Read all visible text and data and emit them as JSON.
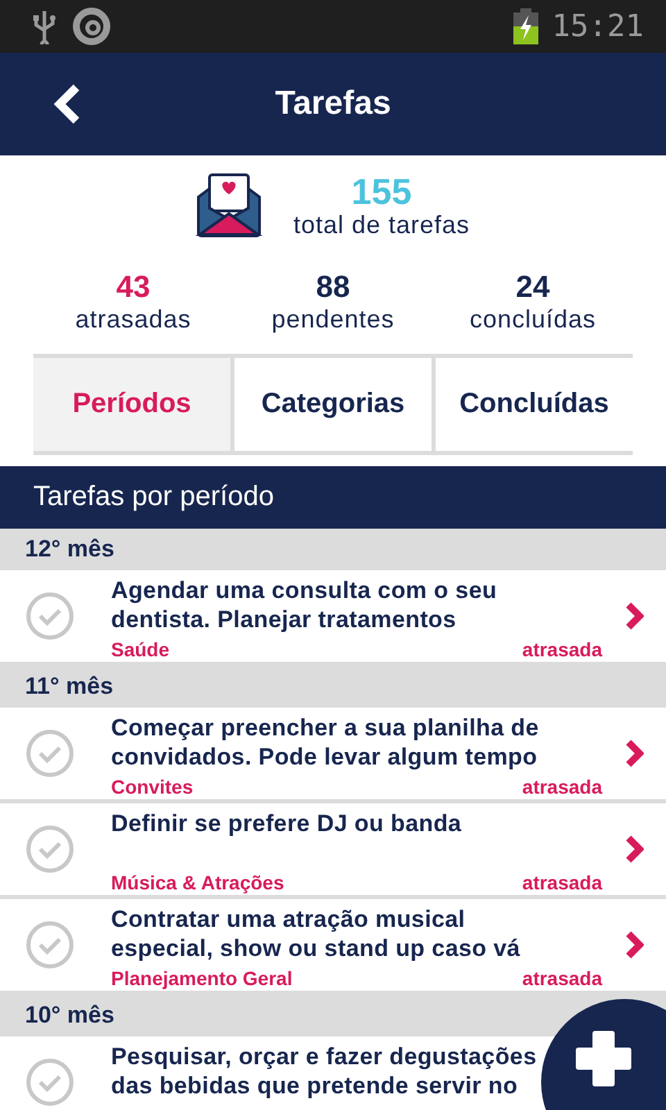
{
  "status_bar": {
    "time": "15:21"
  },
  "header": {
    "title": "Tarefas"
  },
  "summary": {
    "total": "155",
    "total_label": "total de tarefas",
    "stats": [
      {
        "value": "43",
        "label": "atrasadas",
        "color": "#d81b5c"
      },
      {
        "value": "88",
        "label": "pendentes",
        "color": "#17264f"
      },
      {
        "value": "24",
        "label": "concluídas",
        "color": "#17264f"
      }
    ]
  },
  "tabs": [
    {
      "label": "Períodos",
      "selected": true
    },
    {
      "label": "Categorias",
      "selected": false
    },
    {
      "label": "Concluídas",
      "selected": false
    }
  ],
  "section": {
    "title": "Tarefas por período"
  },
  "groups": [
    {
      "title": "12° mês",
      "tasks": [
        {
          "title": "Agendar uma consulta com o seu dentista. Planejar tratamentos",
          "category": "Saúde",
          "status": "atrasada",
          "checked": false
        }
      ]
    },
    {
      "title": "11° mês",
      "tasks": [
        {
          "title": "Começar preencher a sua planilha de convidados. Pode levar algum tempo",
          "category": "Convites",
          "status": "atrasada",
          "checked": false
        },
        {
          "title": "Definir se prefere DJ ou banda",
          "category": "Música & Atrações",
          "status": "atrasada",
          "checked": false
        },
        {
          "title": "Contratar uma atração musical especial, show ou stand up caso vá",
          "category": "Planejamento Geral",
          "status": "atrasada",
          "checked": false
        }
      ]
    },
    {
      "title": "10° mês",
      "tasks": [
        {
          "title": "Pesquisar, orçar e fazer degustações das bebidas que pretende servir no",
          "checked": false
        }
      ]
    }
  ]
}
